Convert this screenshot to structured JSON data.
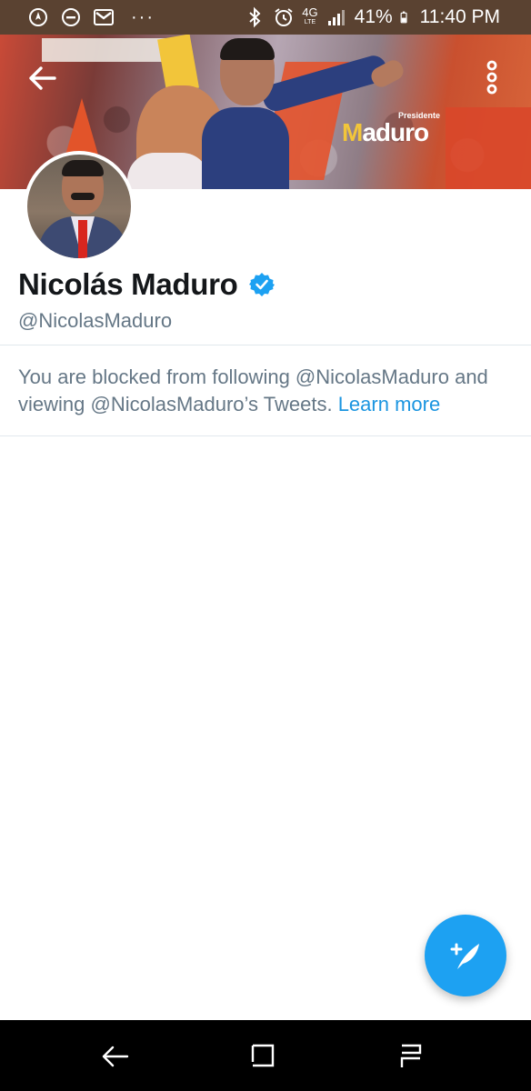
{
  "status_bar": {
    "battery": "41%",
    "time": "11:40 PM",
    "network": "4G",
    "network_sub": "LTE",
    "overflow": "···",
    "icons": [
      "location-icon",
      "do-not-disturb-icon",
      "gmail-icon",
      "bluetooth-icon",
      "alarm-icon",
      "signal-icon",
      "battery-icon"
    ]
  },
  "header": {
    "back_icon": "back-arrow-icon",
    "more_icon": "more-vertical-icon",
    "banner_logo_small": "Presidente",
    "banner_logo_initial": "M",
    "banner_logo_rest": "aduro"
  },
  "profile": {
    "display_name": "Nicolás Maduro",
    "handle": "@NicolasMaduro",
    "verified": true
  },
  "blocked": {
    "message": "You are blocked from following @NicolasMaduro and viewing @NicolasMaduro’s Tweets.",
    "learn_more": "Learn more"
  },
  "fab": {
    "icon": "compose-tweet-icon"
  },
  "nav_bar": {
    "icons": [
      "nav-back-icon",
      "nav-home-icon",
      "nav-recents-icon"
    ]
  },
  "colors": {
    "status_bar_bg": "#5a4231",
    "twitter_blue": "#1da1f2",
    "link_blue": "#1b95e0",
    "text_primary": "#14171a",
    "text_secondary": "#657786",
    "divider": "#e1e8ed"
  }
}
